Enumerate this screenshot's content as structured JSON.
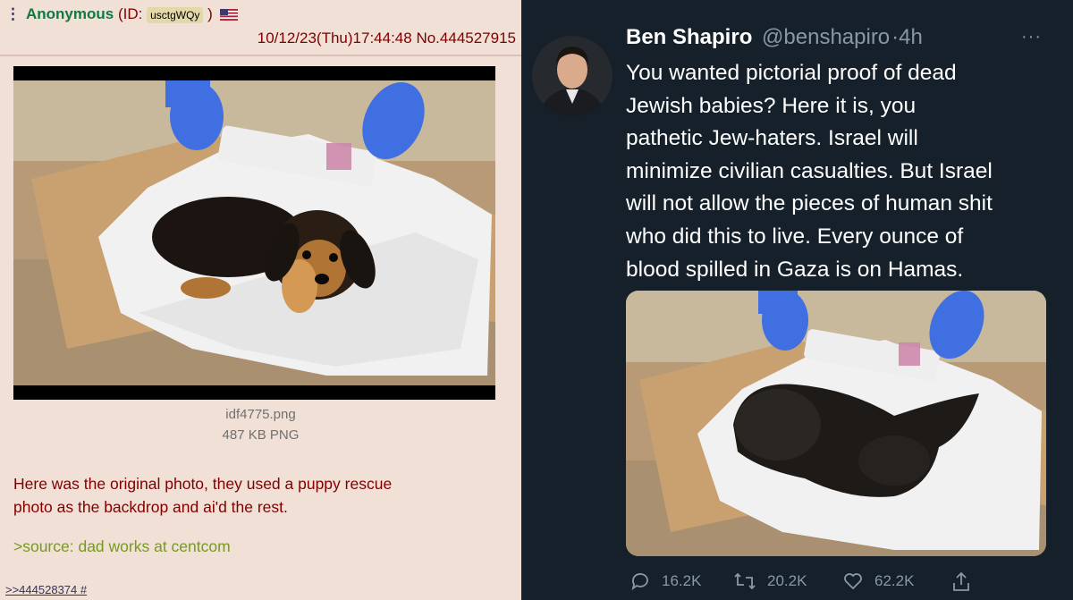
{
  "post": {
    "menu_icon": "vertical-dots",
    "name": "Anonymous",
    "id_label": "(ID:",
    "id_value": "usctgWQy",
    "id_close": ")",
    "flag": "us-flag-icon",
    "datetime": "10/12/23(Thu)17:44:48",
    "number": "No.444527915",
    "file_name": "idf4775.png",
    "file_info": "487 KB PNG",
    "comment_line1": "Here was the original photo, they used a puppy rescue",
    "comment_line2": "photo as the backdrop and ai'd the rest.",
    "greentext": ">source: dad works at centcom",
    "backlink": ">>444528374 #"
  },
  "tweet": {
    "name": "Ben Shapiro",
    "handle": "@benshapiro",
    "dot": "·",
    "time": "4h",
    "more": "···",
    "lines": [
      "You wanted pictorial proof of dead",
      "Jewish babies? Here it is, you",
      "pathetic Jew-haters. Israel will",
      "minimize civilian casualties. But Israel",
      "will not allow the pieces of human shit",
      "who did this to live. Every ounce of",
      "blood spilled in Gaza is on Hamas."
    ],
    "replies": "16.2K",
    "retweets": "20.2K",
    "likes": "62.2K"
  },
  "colors": {
    "post_bg": "#f0e0d6",
    "name_green": "#117743",
    "maroon": "#800000",
    "greentext": "#789922",
    "tweet_bg": "#15202b",
    "tweet_muted": "#8899a6"
  }
}
